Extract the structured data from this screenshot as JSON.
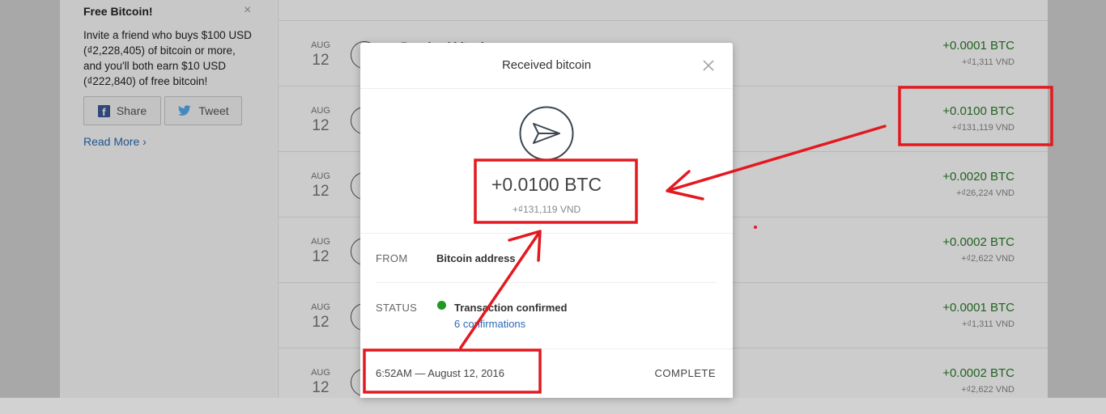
{
  "promo": {
    "title": "Free Bitcoin!",
    "close": "×",
    "text": "Invite a friend who buys $100 USD (₫2,228,405) of bitcoin or more, and you'll both earn $10 USD (₫222,840) of free bitcoin!",
    "share_label": "Share",
    "tweet_label": "Tweet",
    "read_more": "Read More ›"
  },
  "transactions": [
    {
      "month": "AUG",
      "day": "12",
      "title": "Received bitcoin",
      "btc": "+0.0001 BTC",
      "vnd": "+₫1,311 VND"
    },
    {
      "month": "AUG",
      "day": "12",
      "title": "",
      "btc": "+0.0100 BTC",
      "vnd": "+₫131,119 VND"
    },
    {
      "month": "AUG",
      "day": "12",
      "title": "",
      "btc": "+0.0020 BTC",
      "vnd": "+₫26,224 VND"
    },
    {
      "month": "AUG",
      "day": "12",
      "title": "",
      "btc": "+0.0002 BTC",
      "vnd": "+₫2,622 VND"
    },
    {
      "month": "AUG",
      "day": "12",
      "title": "",
      "btc": "+0.0001 BTC",
      "vnd": "+₫1,311 VND"
    },
    {
      "month": "AUG",
      "day": "12",
      "title": "",
      "btc": "+0.0002 BTC",
      "vnd": "+₫2,622 VND"
    }
  ],
  "modal": {
    "title": "Received bitcoin",
    "amount_btc": "+0.0100 BTC",
    "amount_vnd": "+₫131,119 VND",
    "from_label": "FROM",
    "from_value": "Bitcoin address",
    "status_label": "STATUS",
    "status_value": "Transaction confirmed",
    "confirmations": "6 confirmations",
    "date": "6:52AM — August 12, 2016",
    "state": "COMPLETE"
  },
  "colors": {
    "positive": "#2c7b2c",
    "link": "#2a6bb3",
    "annotation": "#e3191f",
    "status_ok": "#1f9a1f"
  },
  "icons": [
    "close-icon",
    "facebook-icon",
    "twitter-icon",
    "sent-arrow-icon"
  ]
}
